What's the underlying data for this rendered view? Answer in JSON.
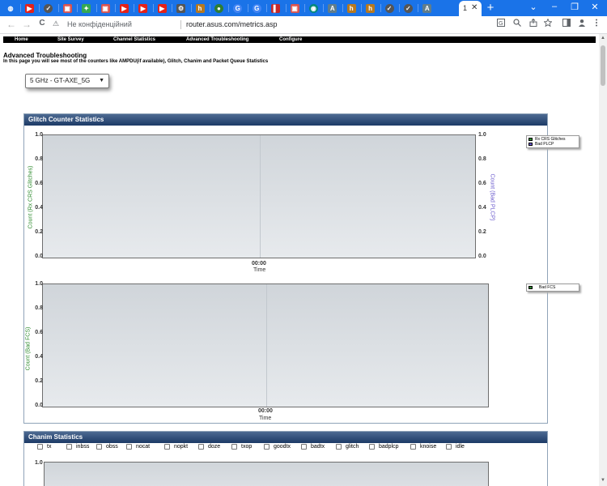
{
  "browser": {
    "tabs": [
      {
        "icon": "globe-icon",
        "color": "#1a73e8"
      },
      {
        "icon": "youtube-icon",
        "color": "#e62117"
      },
      {
        "icon": "circle-check-icon",
        "color": "#555555"
      },
      {
        "icon": "image-icon",
        "color": "#d9534f"
      },
      {
        "icon": "colorful-icon",
        "color": "#34a853"
      },
      {
        "icon": "image-icon",
        "color": "#d9534f"
      },
      {
        "icon": "youtube-icon",
        "color": "#e62117"
      },
      {
        "icon": "youtube-icon",
        "color": "#e62117"
      },
      {
        "icon": "youtube-icon",
        "color": "#e62117"
      },
      {
        "icon": "gear-icon",
        "color": "#555555"
      },
      {
        "icon": "h-icon",
        "color": "#b7791f"
      },
      {
        "icon": "green-circle-icon",
        "color": "#2e7d32"
      },
      {
        "icon": "google-icon",
        "color": "#4285f4"
      },
      {
        "icon": "google-icon",
        "color": "#4285f4"
      },
      {
        "icon": "bookmark-icon",
        "color": "#c62828"
      },
      {
        "icon": "image-icon",
        "color": "#d9534f"
      },
      {
        "icon": "chat-icon",
        "color": "#00897b"
      },
      {
        "icon": "a-icon",
        "color": "#607d8b"
      },
      {
        "icon": "h-icon",
        "color": "#b7791f"
      },
      {
        "icon": "h-icon",
        "color": "#b7791f"
      },
      {
        "icon": "circle-check-icon",
        "color": "#555555"
      },
      {
        "icon": "circle-check-icon",
        "color": "#555555"
      },
      {
        "icon": "a-icon",
        "color": "#607d8b"
      }
    ],
    "active_tab": {
      "title": "1",
      "close": "✕"
    },
    "new_tab": "+",
    "window_buttons": {
      "chevron": "⌄",
      "minimize": "–",
      "restore": "❐",
      "close": "✕"
    },
    "toolbar": {
      "back": "←",
      "forward": "→",
      "reload": "C",
      "security_icon": "⚠",
      "security_label": "Не конфіденційний",
      "url": "router.asus.com/metrics.asp"
    }
  },
  "page": {
    "menu": [
      "Home",
      "Site Survey",
      "Channel Statistics",
      "Advanced Troubleshooting",
      "Configure"
    ],
    "title": "Advanced Troubleshooting",
    "description": "In this page you will see most of the counters like AMPDU(if available), Glitch, Chanim and Packet Queue Statistics",
    "band_select": {
      "selected": "5 GHz - GT-AXE_5G"
    },
    "glitch_panel": {
      "title": "Glitch Counter Statistics",
      "chart1": {
        "y_ticks": [
          "1.0",
          "0.8",
          "0.6",
          "0.4",
          "0.2",
          "0.0"
        ],
        "y2_ticks": [
          "1.0",
          "0.8",
          "0.6",
          "0.4",
          "0.2",
          "0.0"
        ],
        "x_tick": "00:00",
        "xlabel": "Time",
        "ylabel": "Count (Rx CRS Glitches)",
        "y2label": "Count (Bad PLCP)",
        "ylabel_color": "#2e8b2e",
        "y2label_color": "#6a5acd",
        "legend": [
          {
            "label": "Rx CRS Glitches",
            "color": "#2e8b2e"
          },
          {
            "label": "Bad PLCP",
            "color": "#6a5acd"
          }
        ]
      },
      "chart2": {
        "y_ticks": [
          "1.0",
          "0.8",
          "0.6",
          "0.4",
          "0.2",
          "0.0"
        ],
        "x_tick": "00:00",
        "xlabel": "Time",
        "ylabel": "Count (Bad FCS)",
        "ylabel_color": "#2e8b2e",
        "legend": [
          {
            "label": "Bad FCS",
            "color": "#2e8b2e"
          }
        ]
      }
    },
    "chanim_panel": {
      "title": "Chanim Statistics",
      "checkboxes": [
        "tx",
        "inbss",
        "obss",
        "nocat",
        "nopkt",
        "doze",
        "txop",
        "goodtx",
        "badtx",
        "glitch",
        "badplcp",
        "knoise",
        "idle"
      ],
      "chart": {
        "y_top": "1.0"
      }
    }
  },
  "chart_data": [
    {
      "type": "line",
      "ylabel": "Count (Rx CRS Glitches)",
      "y2label": "Count (Bad PLCP)",
      "xlabel": "Time",
      "x": [
        "00:00"
      ],
      "ylim": [
        0,
        1
      ],
      "series": [
        {
          "name": "Rx CRS Glitches",
          "values": []
        },
        {
          "name": "Bad PLCP",
          "values": []
        }
      ]
    },
    {
      "type": "line",
      "ylabel": "Count (Bad FCS)",
      "xlabel": "Time",
      "x": [
        "00:00"
      ],
      "ylim": [
        0,
        1
      ],
      "series": [
        {
          "name": "Bad FCS",
          "values": []
        }
      ]
    }
  ]
}
